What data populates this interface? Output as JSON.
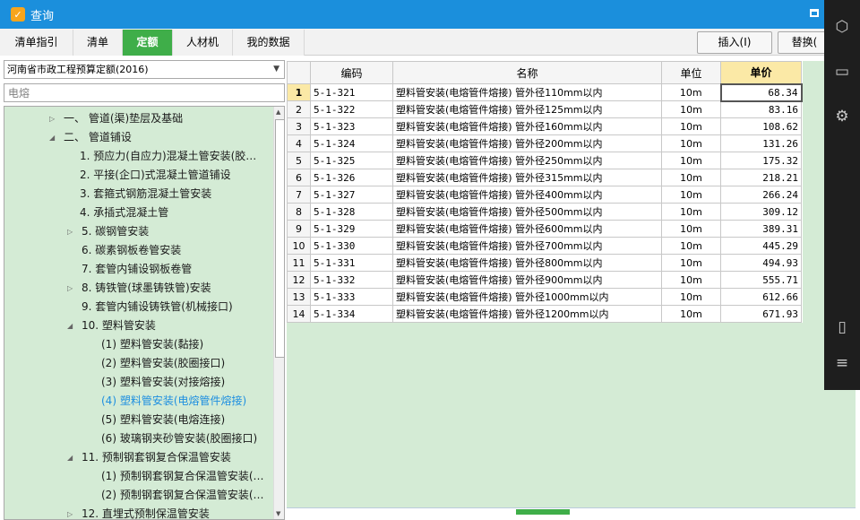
{
  "window": {
    "title": "查询"
  },
  "tabs": [
    "清单指引",
    "清单",
    "定额",
    "人材机",
    "我的数据"
  ],
  "active_tab": "定额",
  "toolbar": {
    "insert_label": "插入(I)",
    "replace_label": "替换("
  },
  "quota_select": {
    "value": "河南省市政工程预算定额(2016)"
  },
  "search": {
    "value": "电熔"
  },
  "tree": [
    {
      "label": "一、 管道(渠)垫层及基础",
      "toggle": "▷"
    },
    {
      "label": "二、 管道铺设",
      "toggle": "◢"
    },
    {
      "label": "1. 预应力(自应力)混凝土管安装(胶…",
      "toggle": ""
    },
    {
      "label": "2. 平接(企口)式混凝土管道铺设",
      "toggle": ""
    },
    {
      "label": "3. 套箍式钢筋混凝土管安装",
      "toggle": ""
    },
    {
      "label": "4. 承插式混凝土管",
      "toggle": ""
    },
    {
      "label": "5. 碳钢管安装",
      "toggle": "▷"
    },
    {
      "label": "6. 碳素钢板卷管安装",
      "toggle": ""
    },
    {
      "label": "7. 套管内铺设钢板卷管",
      "toggle": ""
    },
    {
      "label": "8. 铸铁管(球墨铸铁管)安装",
      "toggle": "▷"
    },
    {
      "label": "9. 套管内铺设铸铁管(机械接口)",
      "toggle": ""
    },
    {
      "label": "10. 塑料管安装",
      "toggle": "◢"
    },
    {
      "label": "(1) 塑料管安装(黏接)",
      "toggle": ""
    },
    {
      "label": "(2) 塑料管安装(胶圈接口)",
      "toggle": ""
    },
    {
      "label": "(3) 塑料管安装(对接熔接)",
      "toggle": ""
    },
    {
      "label": "(4) 塑料管安装(电熔管件熔接)",
      "toggle": ""
    },
    {
      "label": "(5) 塑料管安装(电熔连接)",
      "toggle": ""
    },
    {
      "label": "(6) 玻璃钢夹砂管安装(胶圈接口)",
      "toggle": ""
    },
    {
      "label": "11. 预制钢套钢复合保温管安装",
      "toggle": "◢"
    },
    {
      "label": "(1) 预制钢套钢复合保温管安装(…",
      "toggle": ""
    },
    {
      "label": "(2) 预制钢套钢复合保温管安装(…",
      "toggle": ""
    },
    {
      "label": "12. 直埋式预制保温管安装",
      "toggle": "▷"
    }
  ],
  "selected_tree_item": "(4) 塑料管安装(电熔管件熔接)",
  "grid": {
    "columns": [
      "编码",
      "名称",
      "单位",
      "单价"
    ],
    "rows": [
      {
        "no": "1",
        "code": "5-1-321",
        "name": "塑料管安装(电熔管件熔接) 管外径110mm以内",
        "unit": "10m",
        "price": "68.34"
      },
      {
        "no": "2",
        "code": "5-1-322",
        "name": "塑料管安装(电熔管件熔接) 管外径125mm以内",
        "unit": "10m",
        "price": "83.16"
      },
      {
        "no": "3",
        "code": "5-1-323",
        "name": "塑料管安装(电熔管件熔接) 管外径160mm以内",
        "unit": "10m",
        "price": "108.62"
      },
      {
        "no": "4",
        "code": "5-1-324",
        "name": "塑料管安装(电熔管件熔接) 管外径200mm以内",
        "unit": "10m",
        "price": "131.26"
      },
      {
        "no": "5",
        "code": "5-1-325",
        "name": "塑料管安装(电熔管件熔接) 管外径250mm以内",
        "unit": "10m",
        "price": "175.32"
      },
      {
        "no": "6",
        "code": "5-1-326",
        "name": "塑料管安装(电熔管件熔接) 管外径315mm以内",
        "unit": "10m",
        "price": "218.21"
      },
      {
        "no": "7",
        "code": "5-1-327",
        "name": "塑料管安装(电熔管件熔接) 管外径400mm以内",
        "unit": "10m",
        "price": "266.24"
      },
      {
        "no": "8",
        "code": "5-1-328",
        "name": "塑料管安装(电熔管件熔接) 管外径500mm以内",
        "unit": "10m",
        "price": "309.12"
      },
      {
        "no": "9",
        "code": "5-1-329",
        "name": "塑料管安装(电熔管件熔接) 管外径600mm以内",
        "unit": "10m",
        "price": "389.31"
      },
      {
        "no": "10",
        "code": "5-1-330",
        "name": "塑料管安装(电熔管件熔接) 管外径700mm以内",
        "unit": "10m",
        "price": "445.29"
      },
      {
        "no": "11",
        "code": "5-1-331",
        "name": "塑料管安装(电熔管件熔接) 管外径800mm以内",
        "unit": "10m",
        "price": "494.93"
      },
      {
        "no": "12",
        "code": "5-1-332",
        "name": "塑料管安装(电熔管件熔接) 管外径900mm以内",
        "unit": "10m",
        "price": "555.71"
      },
      {
        "no": "13",
        "code": "5-1-333",
        "name": "塑料管安装(电熔管件熔接) 管外径1000mm以内",
        "unit": "10m",
        "price": "612.66"
      },
      {
        "no": "14",
        "code": "5-1-334",
        "name": "塑料管安装(电熔管件熔接) 管外径1200mm以内",
        "unit": "10m",
        "price": "671.93"
      }
    ]
  },
  "side_icons": [
    "cube-icon",
    "folder-icon",
    "gear-icon",
    "phone-icon",
    "menu-icon"
  ],
  "colors": {
    "title_bar": "#1b8fdc",
    "active_tab": "#3fae49",
    "tree_bg": "#d4ebd5",
    "header_highlight": "#fbe9a6",
    "selected_text": "#1e8fe0"
  }
}
